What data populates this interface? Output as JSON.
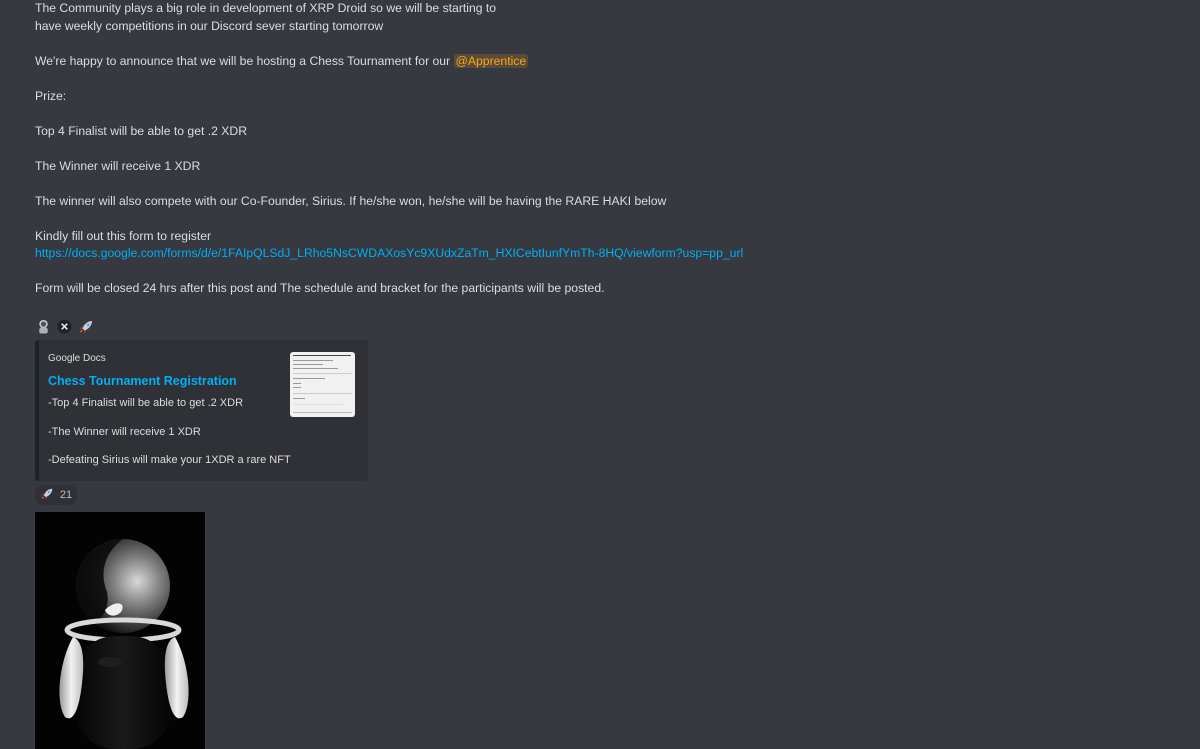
{
  "message": {
    "line1": "The Community plays a big role in development of XRP Droid so we will be starting to",
    "line2": "have weekly competitions in our Discord sever starting tomorrow",
    "announce_prefix": "We're happy to announce that we will be hosting a Chess Tournament for our ",
    "mention": "@Apprentice",
    "prize_label": "Prize:",
    "top4": "Top 4 Finalist will be able to get .2 XDR",
    "winner": "The Winner will receive 1 XDR",
    "cofounder": "The winner will also compete with our Co-Founder, Sirius. If he/she won, he/she will be having the RARE HAKI below",
    "form_prompt": "Kindly fill out this form to register",
    "form_link": "https://docs.google.com/forms/d/e/1FAIpQLSdJ_LRho5NsCWDAXosYc9XUdxZaTm_HXICebtIunfYmTh-8HQ/viewform?usp=pp_url",
    "closing": "Form will be closed 24 hrs after this post and The schedule and bracket for the participants will be posted."
  },
  "inline_emojis": [
    "astronaut-icon",
    "close-circle-icon",
    "rocket-icon"
  ],
  "embed": {
    "provider": "Google Docs",
    "title": "Chess Tournament Registration",
    "desc1": "-Top 4 Finalist will be able to get .2 XDR",
    "desc2": "-The Winner will receive 1 XDR",
    "desc3": "-Defeating Sirius will make your 1XDR a rare NFT"
  },
  "reaction": {
    "emoji": "rocket-icon",
    "count": "21"
  },
  "colors": {
    "background": "#36393f",
    "link": "#00aff4",
    "mention": "#faa61a",
    "embed_bg": "#2f3136"
  }
}
